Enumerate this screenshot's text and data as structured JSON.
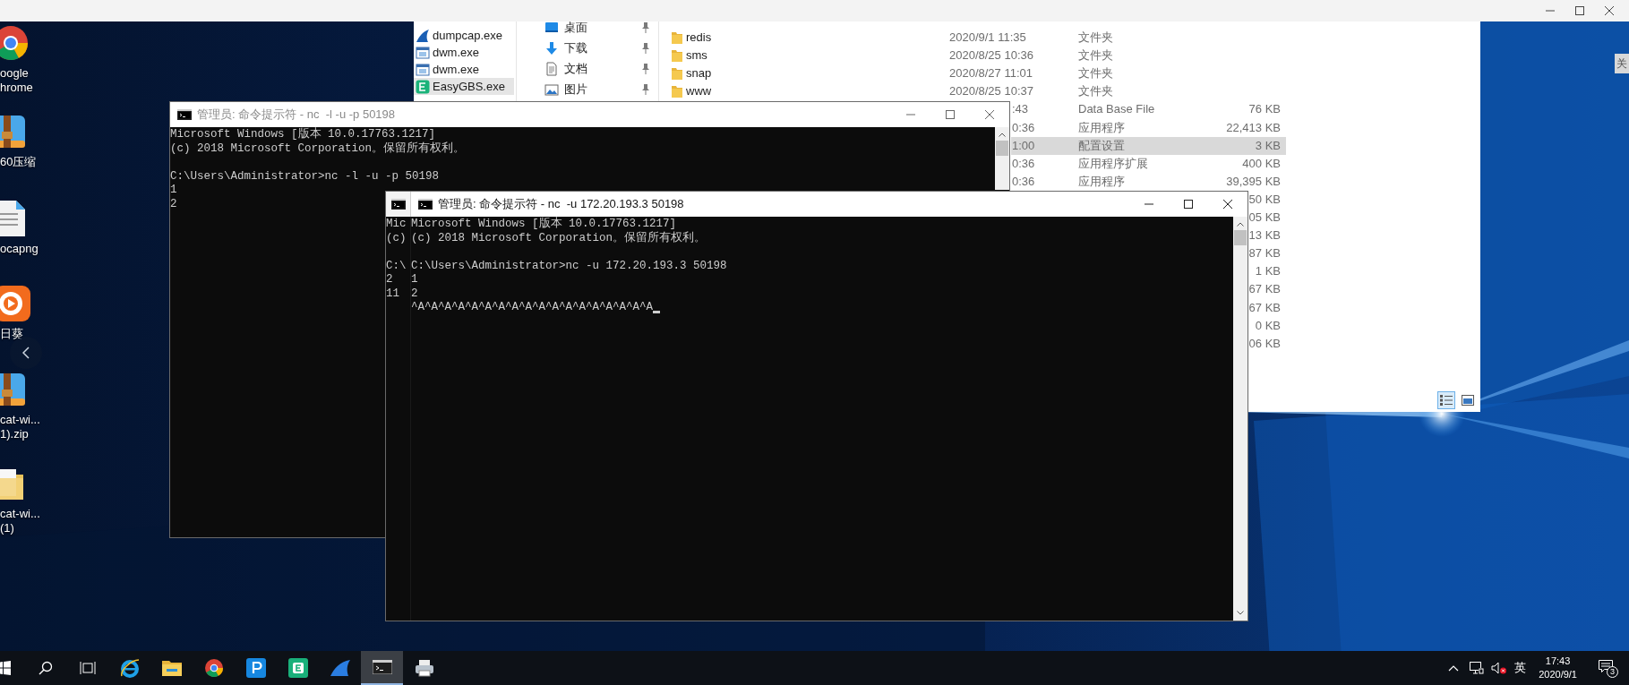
{
  "explorer": {
    "left_list": [
      {
        "kind": "shark",
        "name": "dumpcap.exe",
        "selected": false
      },
      {
        "kind": "window",
        "name": "dwm.exe",
        "selected": false
      },
      {
        "kind": "window",
        "name": "dwm.exe",
        "selected": false
      },
      {
        "kind": "easygbs",
        "name": "EasyGBS.exe",
        "selected": true
      }
    ],
    "quick_access": [
      {
        "kind": "desktop",
        "label": "桌面"
      },
      {
        "kind": "download",
        "label": "下载"
      },
      {
        "kind": "document",
        "label": "文档"
      },
      {
        "kind": "pictures",
        "label": "图片"
      }
    ],
    "rows": [
      {
        "kind": "folder",
        "name": "redis",
        "date": "2020/9/1 11:35",
        "type": "文件夹",
        "selected": false
      },
      {
        "kind": "folder",
        "name": "sms",
        "date": "2020/8/25 10:36",
        "type": "文件夹",
        "selected": false
      },
      {
        "kind": "folder",
        "name": "snap",
        "date": "2020/8/27 11:01",
        "type": "文件夹",
        "selected": false
      },
      {
        "kind": "folder",
        "name": "www",
        "date": "2020/8/25 10:37",
        "type": "文件夹",
        "selected": false
      },
      {
        "kind": "file",
        "date": ":43",
        "type": "Data Base File",
        "size": "76 KB",
        "selected": false
      },
      {
        "kind": "file",
        "date": "0:36",
        "type": "应用程序",
        "size": "22,413 KB",
        "selected": false
      },
      {
        "kind": "file",
        "date": "1:00",
        "type": "配置设置",
        "size": "3 KB",
        "selected": true
      },
      {
        "kind": "file",
        "date": "0:36",
        "type": "应用程序扩展",
        "size": "400 KB",
        "selected": false
      },
      {
        "kind": "file",
        "date": "0:36",
        "type": "应用程序",
        "size": "39,395 KB",
        "selected": false
      },
      {
        "kind": "file",
        "size": "50 KB",
        "selected": false
      },
      {
        "kind": "file",
        "size": "05 KB",
        "selected": false
      },
      {
        "kind": "file",
        "size": "13 KB",
        "selected": false
      },
      {
        "kind": "file",
        "size": "87 KB",
        "selected": false
      },
      {
        "kind": "file",
        "size": "1 KB",
        "selected": false
      },
      {
        "kind": "file",
        "size": "67 KB",
        "selected": false
      },
      {
        "kind": "file",
        "size": "67 KB",
        "selected": false
      },
      {
        "kind": "file",
        "size": "0 KB",
        "selected": false
      },
      {
        "kind": "file",
        "size": "06 KB",
        "selected": false
      }
    ],
    "view_modes": [
      {
        "kind": "details",
        "selected": true
      },
      {
        "kind": "preview",
        "selected": false
      }
    ]
  },
  "desktop_icons": [
    {
      "kind": "chrome",
      "label_lines": [
        "oogle",
        "hrome"
      ]
    },
    {
      "kind": "archive",
      "label_lines": [
        "60压缩"
      ]
    },
    {
      "kind": "binary",
      "label_lines": [
        "ocapng"
      ]
    },
    {
      "kind": "sunflower",
      "label_lines": [
        "日葵"
      ]
    },
    {
      "kind": "archive",
      "label_lines": [
        "cat-wi...",
        "1).zip"
      ]
    },
    {
      "kind": "folder",
      "label_lines": [
        "cat-wi...",
        "(1)"
      ]
    }
  ],
  "side_tab": "关",
  "terminals": [
    {
      "title": "管理员: 命令提示符 - nc  -l -u -p 50198",
      "active": false,
      "paragraphs": [
        [
          "Microsoft Windows [版本 10.0.17763.1217]",
          "(c) 2018 Microsoft Corporation。保留所有权利。"
        ],
        [
          "C:\\Users\\Administrator>nc -l -u -p 50198",
          "1",
          "2"
        ]
      ]
    },
    {
      "title": "管理员: 命令提示符 - nc  -u 172.20.193.3 50198",
      "active": true,
      "paragraphs": [
        [
          "Microsoft Windows [版本 10.0.17763.1217]",
          "(c) 2018 Microsoft Corporation。保留所有权利。"
        ],
        [
          "C:\\Users\\Administrator>nc -u 172.20.193.3 50198",
          "1",
          "2",
          "^A^A^A^A^A^A^A^A^A^A^A^A^A^A^A^A^A^A"
        ]
      ],
      "ghost_paragraphs": [
        [
          "Mic",
          "(c)"
        ],
        [
          "C:\\",
          "2",
          "11"
        ]
      ],
      "cursor": true
    }
  ],
  "taskbar": {
    "items": [
      {
        "kind": "start",
        "active": false
      },
      {
        "kind": "search",
        "active": false
      },
      {
        "kind": "taskview",
        "active": false
      },
      {
        "kind": "ie",
        "active": false
      },
      {
        "kind": "explorer",
        "active": false
      },
      {
        "kind": "chrome",
        "active": false
      },
      {
        "kind": "p-app",
        "active": false
      },
      {
        "kind": "e-app",
        "active": false
      },
      {
        "kind": "shark",
        "active": false
      },
      {
        "kind": "cmd",
        "active": true
      },
      {
        "kind": "printer",
        "active": false
      }
    ],
    "tray": {
      "ime": "英",
      "time": "17:43",
      "date": "2020/9/1",
      "notifications": "3"
    }
  }
}
